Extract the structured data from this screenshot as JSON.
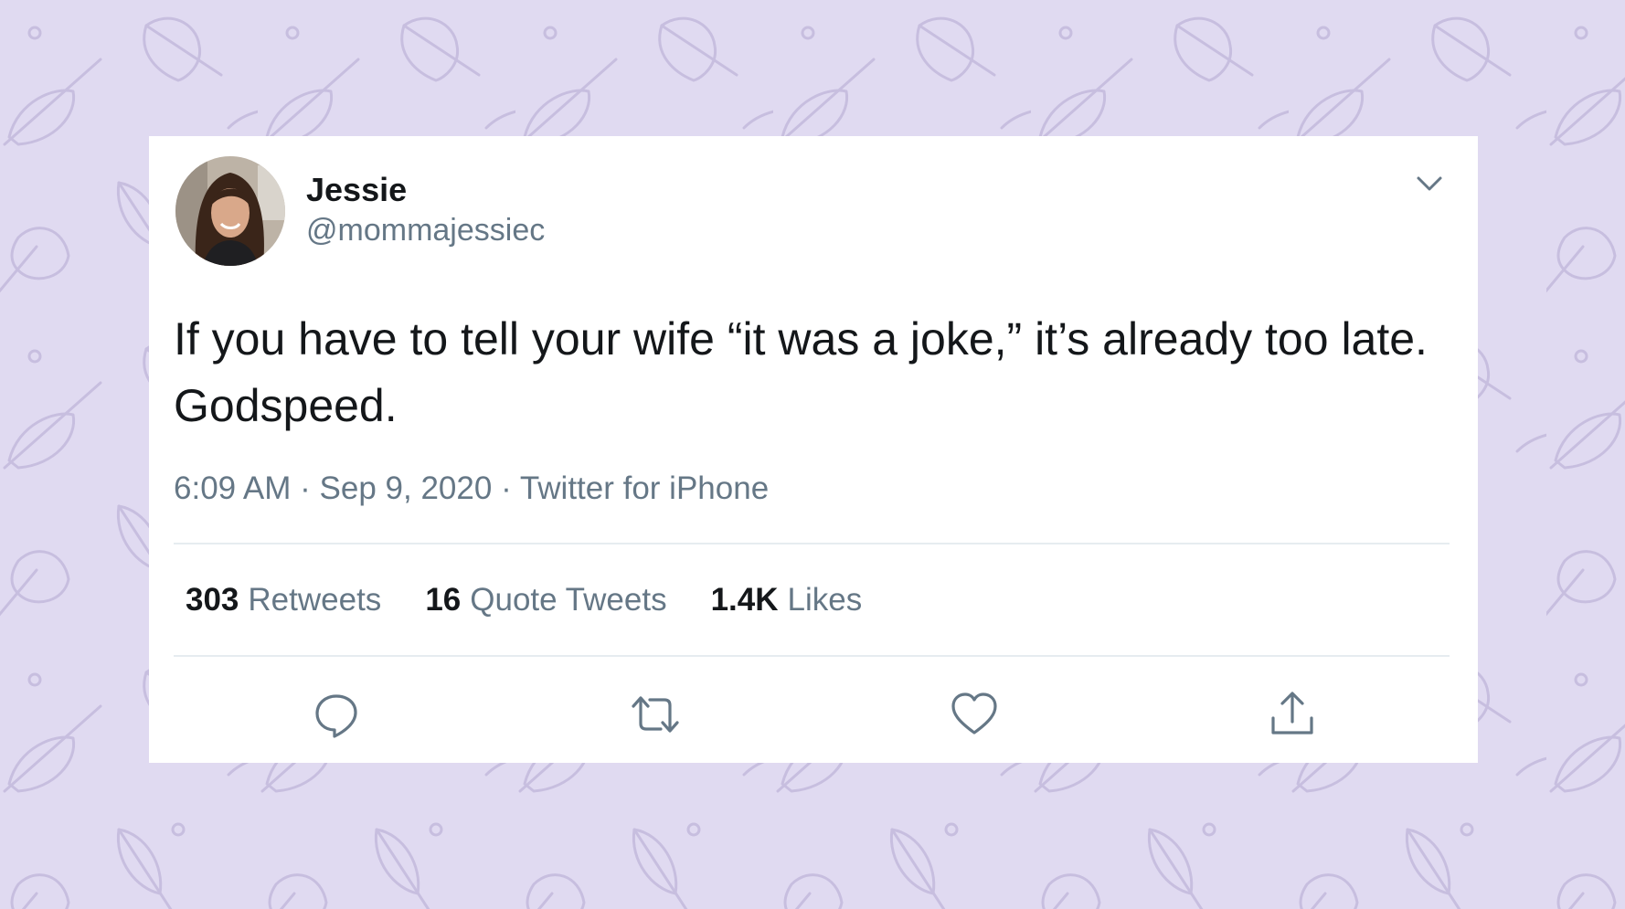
{
  "colors": {
    "background": "#e0daf1",
    "pattern_stroke": "#c7bedf",
    "card": "#ffffff",
    "text_primary": "#14171a",
    "text_secondary": "#657786",
    "divider": "#e6ecf0"
  },
  "tweet": {
    "author": {
      "name": "Jessie",
      "handle": "@mommajessiec",
      "avatar_icon": "profile-photo"
    },
    "text": "If you have to tell your wife “it was a joke,” it’s already too late. Godspeed.",
    "time": "6:09 AM",
    "date": "Sep 9, 2020",
    "source": "Twitter for iPhone",
    "separator": "·",
    "stats": {
      "retweets": {
        "count": "303",
        "label": "Retweets"
      },
      "quote_tweets": {
        "count": "16",
        "label": "Quote Tweets"
      },
      "likes": {
        "count": "1.4K",
        "label": "Likes"
      }
    },
    "menu_icon": "chevron-down-icon",
    "actions": [
      "reply-icon",
      "retweet-icon",
      "like-icon",
      "share-icon"
    ]
  }
}
